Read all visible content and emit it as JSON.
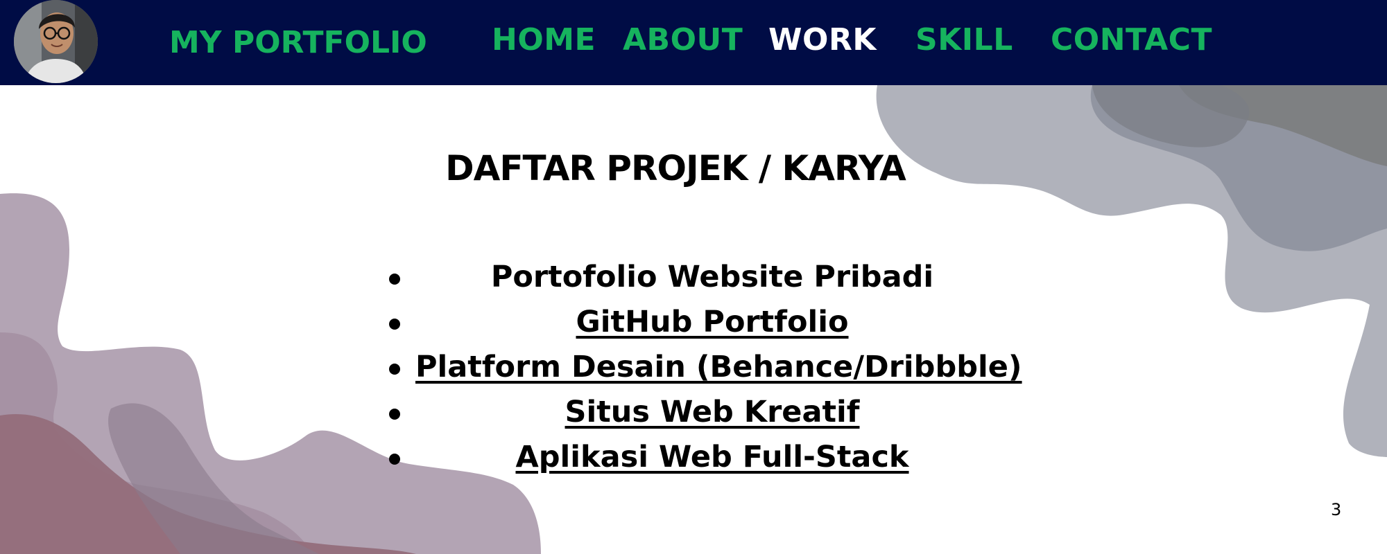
{
  "header": {
    "brand": "MY PORTFOLIO",
    "nav": [
      {
        "label": "HOME"
      },
      {
        "label": "ABOUT"
      },
      {
        "label": "WORK"
      },
      {
        "label": "SKILL"
      },
      {
        "label": "CONTACT"
      }
    ],
    "active_nav": "WORK"
  },
  "main": {
    "title": "DAFTAR PROJEK / KARYA",
    "projects": [
      {
        "label": "Portofolio Website Pribadi",
        "linked": false
      },
      {
        "label": "GitHub Portfolio",
        "linked": true
      },
      {
        "label": "Platform Desain (Behance/Dribbble)",
        "linked": true
      },
      {
        "label": "Situs Web Kreatif",
        "linked": true
      },
      {
        "label": "Aplikasi Web Full-Stack",
        "linked": true
      }
    ]
  },
  "footer": {
    "page_number": "3"
  },
  "colors": {
    "navbar_bg": "#000c45",
    "nav_text": "#16b35e",
    "nav_active": "#ffffff",
    "blob_gray": "#a7aab4",
    "blob_mauve": "#b3a4b4",
    "blob_rose": "#946e7b"
  }
}
